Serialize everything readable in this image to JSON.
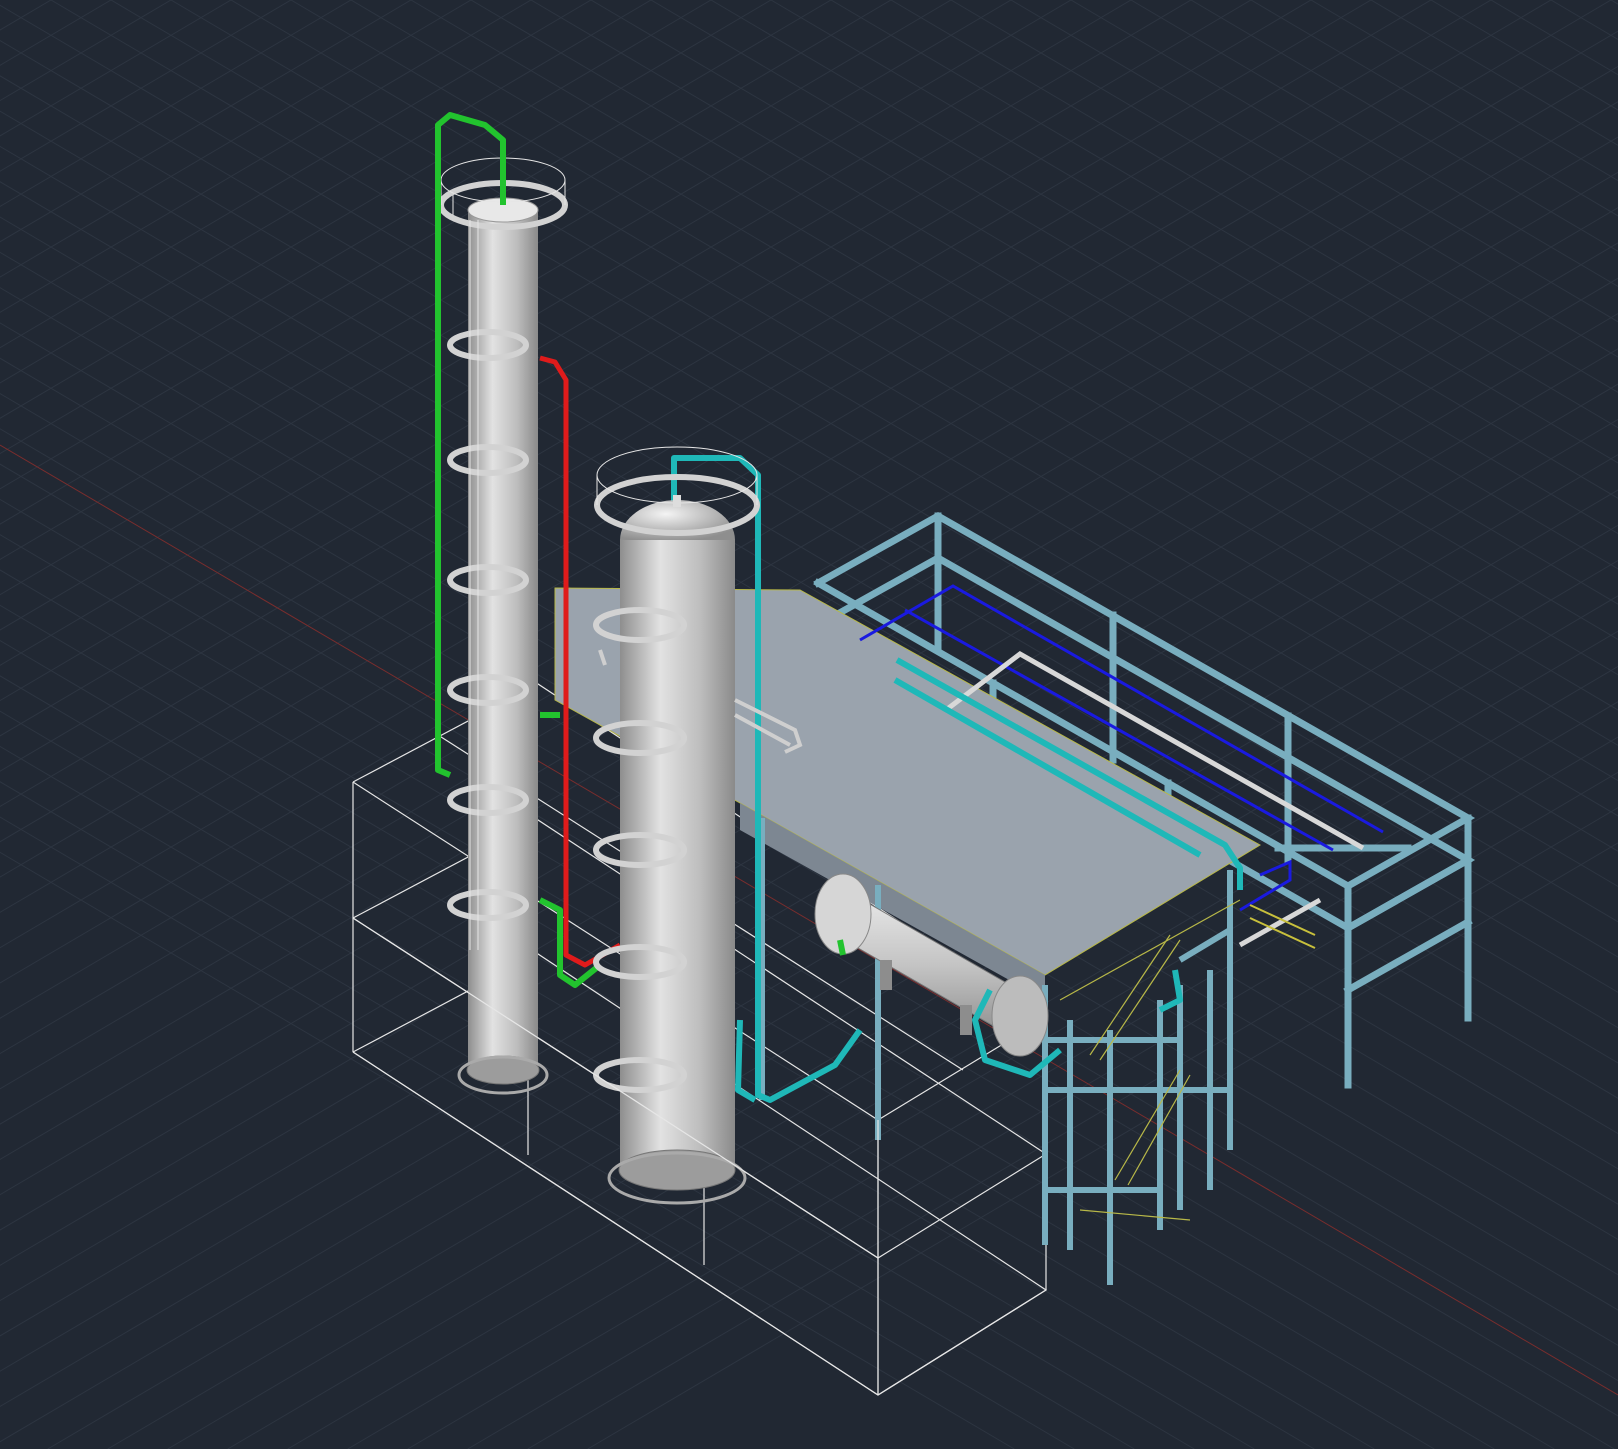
{
  "viewport": {
    "background_color": "#212833",
    "grid_color": "#2d3541",
    "x_axis_color": "#8b2f2f",
    "visual_style": "shaded"
  },
  "model": {
    "objects": [
      {
        "name": "tall-column",
        "color": "#c0c0c0"
      },
      {
        "name": "short-column",
        "color": "#c0c0c0"
      },
      {
        "name": "horizontal-drum",
        "color": "#c8c8c8"
      },
      {
        "name": "pipe-rack",
        "color": "#79aebf"
      },
      {
        "name": "elevated-platform",
        "color": "#9aa3ad"
      },
      {
        "name": "green-pipe",
        "color": "#22c32e"
      },
      {
        "name": "red-pipe",
        "color": "#e01b1b"
      },
      {
        "name": "cyan-pipe",
        "color": "#1fb8b8"
      },
      {
        "name": "blue-pipe",
        "color": "#1a1ae0"
      },
      {
        "name": "white-wireframe-frame",
        "color": "#e8e8e8"
      },
      {
        "name": "stair-handrail",
        "color": "#b8b848"
      }
    ]
  }
}
